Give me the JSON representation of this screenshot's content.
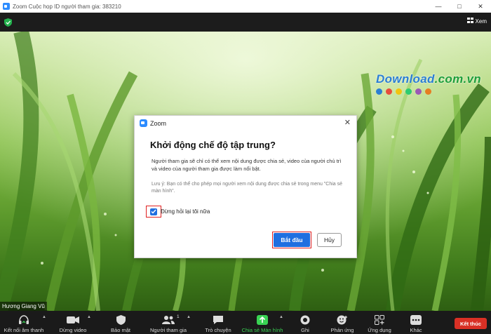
{
  "window": {
    "title": "Zoom Cuộc họp ID người tham gia: 383210",
    "controls": [
      "minimize-icon",
      "maximize-icon",
      "close-icon"
    ]
  },
  "topbar": {
    "view_label": "Xem",
    "security_icon": "shield-check-icon",
    "view_icon": "grid-icon"
  },
  "video": {
    "participant_name": "Hương Giang Vũ",
    "watermark": {
      "text_main": "Download",
      "text_tld": ".com.vn"
    },
    "watermark_dot_colors": [
      "#2b7fd3",
      "#e74c3c",
      "#f1c40f",
      "#2ecc71",
      "#9b59b6",
      "#e67e22"
    ]
  },
  "dialog": {
    "title": "Zoom",
    "heading": "Khởi động chế độ tập trung?",
    "description": "Người tham gia sẽ chỉ có thể xem nội dung được chia sẻ, video của người chủ trì và video của người tham gia được làm nổi bật.",
    "note": "Lưu ý: Bạn có thể cho phép mọi người xem nội dung được chia sẻ trong menu \"Chia sẻ màn hình\".",
    "checkbox_label": "Đừng hỏi lại tôi nữa",
    "checkbox_checked": true,
    "start_button": "Bắt đầu",
    "cancel_button": "Hủy",
    "accent_color": "#1f6fe0",
    "highlight_color": "#e02020"
  },
  "toolbar": {
    "audio": "Kết nối âm thanh",
    "video": "Dừng video",
    "security": "Bảo mật",
    "participants": "Người tham gia",
    "participants_count": "1",
    "chat": "Trò chuyện",
    "share": "Chia sẻ Màn hình",
    "record": "Ghi",
    "reactions": "Phản ứng",
    "apps": "Ứng dụng",
    "more": "Khác",
    "end": "Kết thúc",
    "share_color": "#39d353",
    "end_color": "#d93025"
  }
}
